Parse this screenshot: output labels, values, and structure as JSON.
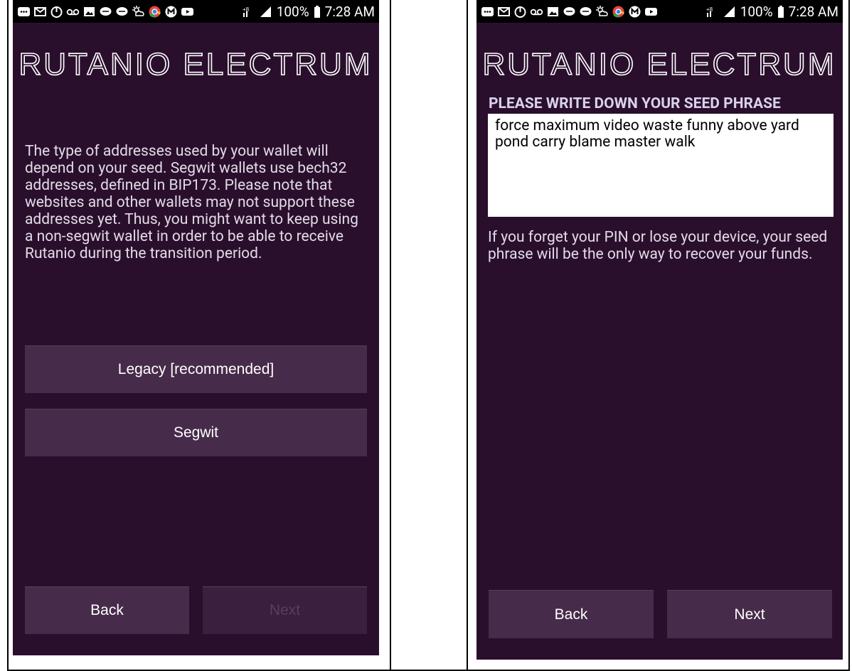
{
  "status_bar": {
    "battery": "100%",
    "time": "7:28 AM"
  },
  "left_screen": {
    "logo_text": "RUTANIO ELECTRUM",
    "description": "The type of addresses used by your wallet will depend on your seed. Segwit wallets use bech32 addresses, defined in BIP173. Please note that websites and other wallets may not support these addresses yet. Thus, you might want to keep using a non-segwit wallet in order to be able to receive Rutanio during the transition period.",
    "option_legacy": "Legacy [recommended]",
    "option_segwit": "Segwit",
    "back_label": "Back",
    "next_label": "Next"
  },
  "right_screen": {
    "logo_text": "RUTANIO ELECTRUM",
    "seed_title": "PLEASE WRITE DOWN YOUR SEED PHRASE",
    "seed_phrase": "force maximum video waste funny above yard pond carry blame master walk",
    "warning": "If you forget your PIN or lose your device, your seed phrase will be the only way to recover your funds.",
    "back_label": "Back",
    "next_label": "Next"
  },
  "colors": {
    "background": "#2a0f2d",
    "button": "#472b4a",
    "button_disabled": "#3b1f3e"
  }
}
